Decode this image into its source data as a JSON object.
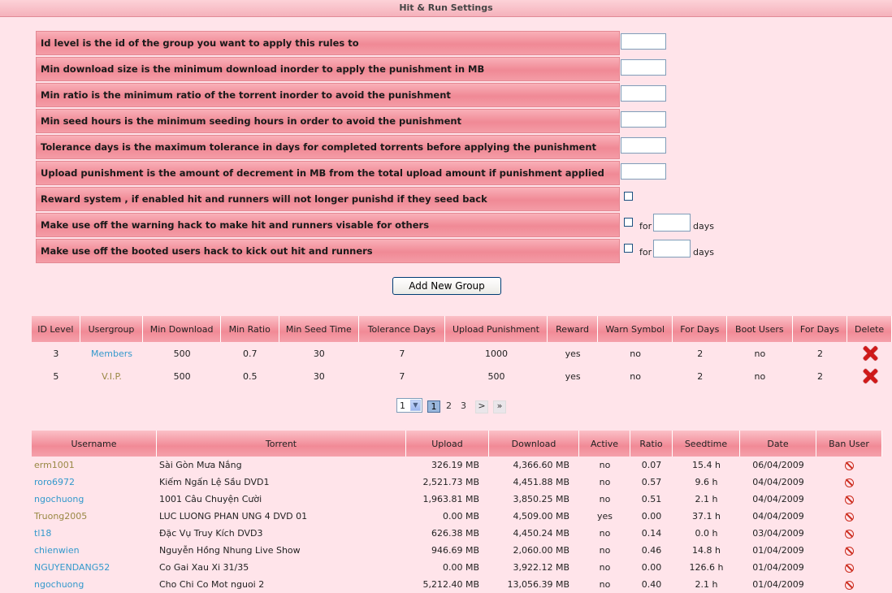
{
  "page_title": "Hit & Run Settings",
  "settings": [
    {
      "label": "Id level is the id of the group you want to apply this rules to",
      "control": "input",
      "value": ""
    },
    {
      "label": "Min download size is the minimum download inorder to apply the punishment in MB",
      "control": "input",
      "value": ""
    },
    {
      "label": "Min ratio is the minimum ratio of the torrent inorder to avoid the punishment",
      "control": "input",
      "value": ""
    },
    {
      "label": "Min seed hours is the minimum seeding hours in order to avoid the punishment",
      "control": "input",
      "value": ""
    },
    {
      "label": "Tolerance days is the maximum tolerance in days for completed torrents before applying the punishment",
      "control": "input",
      "value": ""
    },
    {
      "label": "Upload punishment is the amount of decrement in MB from the total upload amount if punishment applied",
      "control": "input",
      "value": ""
    },
    {
      "label": "Reward system , if enabled hit and runners will not longer punishd if they seed back",
      "control": "checkbox",
      "checked": false
    },
    {
      "label": "Make use off the warning hack to make hit and runners visable for others",
      "control": "checkbox-days",
      "checked": false,
      "for_label": "for",
      "days_value": "",
      "days_label": "days"
    },
    {
      "label": "Make use off the booted users hack to kick out hit and runners",
      "control": "checkbox-days",
      "checked": false,
      "for_label": "for",
      "days_value": "",
      "days_label": "days"
    }
  ],
  "add_group_button": "Add New Group",
  "groups_table": {
    "headers": [
      "ID Level",
      "Usergroup",
      "Min Download",
      "Min Ratio",
      "Min Seed Time",
      "Tolerance Days",
      "Upload Punishment",
      "Reward",
      "Warn Symbol",
      "For Days",
      "Boot Users",
      "For Days",
      "Delete"
    ],
    "rows": [
      {
        "id_level": "3",
        "usergroup": "Members",
        "usergroup_color": "#3399cc",
        "min_download": "500",
        "min_ratio": "0.7",
        "min_seed_time": "30",
        "tolerance_days": "7",
        "upload_punishment": "1000",
        "reward": "yes",
        "warn_symbol": "no",
        "warn_days": "2",
        "boot_users": "no",
        "boot_days": "2"
      },
      {
        "id_level": "5",
        "usergroup": "V.I.P.",
        "usergroup_color": "#998844",
        "min_download": "500",
        "min_ratio": "0.5",
        "min_seed_time": "30",
        "tolerance_days": "7",
        "upload_punishment": "500",
        "reward": "yes",
        "warn_symbol": "no",
        "warn_days": "2",
        "boot_users": "no",
        "boot_days": "2"
      }
    ]
  },
  "pager": {
    "select_value": "1",
    "pages": [
      "1",
      "2",
      "3"
    ],
    "current": "1",
    "next": ">",
    "last": "»"
  },
  "hitrun_table": {
    "headers": [
      "Username",
      "Torrent",
      "Upload",
      "Download",
      "Active",
      "Ratio",
      "Seedtime",
      "Date",
      "Ban User"
    ],
    "rows": [
      {
        "username": "erm1001",
        "user_color": "#998844",
        "torrent": "Sài Gòn Mưa Nắng",
        "upload": "326.19 MB",
        "download": "4,366.60 MB",
        "active": "no",
        "ratio": "0.07",
        "seedtime": "15.4 h",
        "date": "06/04/2009"
      },
      {
        "username": "roro6972",
        "user_color": "#3399cc",
        "torrent": "Kiếm Ngấn Lệ Sầu DVD1",
        "upload": "2,521.73 MB",
        "download": "4,451.88 MB",
        "active": "no",
        "ratio": "0.57",
        "seedtime": "9.6 h",
        "date": "04/04/2009"
      },
      {
        "username": "ngochuong",
        "user_color": "#3399cc",
        "torrent": "1001 Câu Chuyện Cười",
        "upload": "1,963.81 MB",
        "download": "3,850.25 MB",
        "active": "no",
        "ratio": "0.51",
        "seedtime": "2.1 h",
        "date": "04/04/2009"
      },
      {
        "username": "Truong2005",
        "user_color": "#998844",
        "torrent": "LUC LUONG PHAN UNG 4 DVD 01",
        "upload": "0.00 MB",
        "download": "4,509.00 MB",
        "active": "yes",
        "ratio": "0.00",
        "seedtime": "37.1 h",
        "date": "04/04/2009"
      },
      {
        "username": "tl18",
        "user_color": "#3399cc",
        "torrent": "Đặc Vụ Truy Kích DVD3",
        "upload": "626.38 MB",
        "download": "4,450.24 MB",
        "active": "no",
        "ratio": "0.14",
        "seedtime": "0.0 h",
        "date": "03/04/2009"
      },
      {
        "username": "chienwien",
        "user_color": "#3399cc",
        "torrent": "Nguyễn Hồng Nhung Live Show",
        "upload": "946.69 MB",
        "download": "2,060.00 MB",
        "active": "no",
        "ratio": "0.46",
        "seedtime": "14.8 h",
        "date": "01/04/2009"
      },
      {
        "username": "NGUYENDANG52",
        "user_color": "#3399cc",
        "torrent": "Co Gai Xau Xi 31/35",
        "upload": "0.00 MB",
        "download": "3,922.12 MB",
        "active": "no",
        "ratio": "0.00",
        "seedtime": "126.6 h",
        "date": "01/04/2009"
      },
      {
        "username": "ngochuong",
        "user_color": "#3399cc",
        "torrent": "Cho Chi Co Mot nguoi 2",
        "upload": "5,212.40 MB",
        "download": "13,056.39 MB",
        "active": "no",
        "ratio": "0.40",
        "seedtime": "2.1 h",
        "date": "01/04/2009"
      }
    ]
  }
}
